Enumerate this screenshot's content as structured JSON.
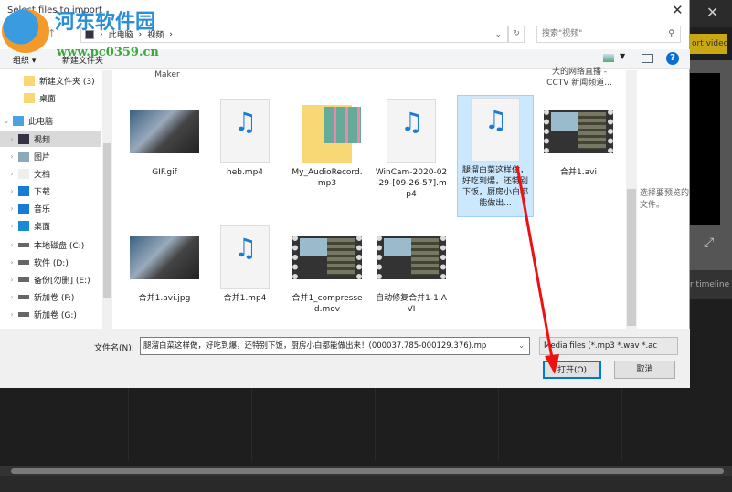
{
  "background_app": {
    "export_label": "ort video",
    "timeline_label": "r timeline"
  },
  "dialog": {
    "title": "Select files to import",
    "breadcrumb": [
      "此电脑",
      "视频"
    ],
    "search_placeholder": "搜索\"视频\"",
    "toolbar": {
      "organize": "组织 ▾",
      "new_folder": "新建文件夹",
      "help": "?"
    },
    "sidebar": [
      {
        "label": "新建文件夹 (3)",
        "icon": "folder"
      },
      {
        "label": "桌面",
        "icon": "folder"
      },
      {
        "label": "此电脑",
        "icon": "computer",
        "expanded": true
      },
      {
        "label": "视频",
        "icon": "video",
        "selected": true
      },
      {
        "label": "图片",
        "icon": "picture"
      },
      {
        "label": "文档",
        "icon": "document"
      },
      {
        "label": "下载",
        "icon": "download"
      },
      {
        "label": "音乐",
        "icon": "music"
      },
      {
        "label": "桌面",
        "icon": "desktop"
      },
      {
        "label": "本地磁盘 (C:)",
        "icon": "drive"
      },
      {
        "label": "软件 (D:)",
        "icon": "drive"
      },
      {
        "label": "备份[勿删] (E:)",
        "icon": "drive"
      },
      {
        "label": "新加卷 (F:)",
        "icon": "drive"
      },
      {
        "label": "新加卷 (G:)",
        "icon": "drive"
      }
    ],
    "cut_off_labels": [
      "Maker",
      "大的网络直播 - CCTV 新闻频道..."
    ],
    "files": [
      {
        "name": "GIF.gif",
        "type": "image"
      },
      {
        "name": "heb.mp4",
        "type": "media"
      },
      {
        "name": "My_AudioRecord.mp3",
        "type": "folder"
      },
      {
        "name": "WinCam-2020-02-29-[09-26-57].mp4",
        "type": "media"
      },
      {
        "name": "腿溜白菜这样做，好吃到爆，还特别下饭，厨房小白都能做出...",
        "type": "media",
        "selected": true
      },
      {
        "name": "合并1.avi",
        "type": "film"
      },
      {
        "name": "合并1.avi.jpg",
        "type": "image"
      },
      {
        "name": "合并1.mp4",
        "type": "media"
      },
      {
        "name": "合并1_compressed.mov",
        "type": "film"
      },
      {
        "name": "自动修复合并1-1.AVI",
        "type": "film"
      }
    ],
    "preview_text": "选择要预览的文件。",
    "filename_label": "文件名(N):",
    "filename_value": "腿溜白菜这样做，好吃到爆，还特别下饭，厨房小白都能做出来！(000037.785-000129.376).mp",
    "filter_value": "Media files (*.mp3 *.wav *.ac",
    "open_label": "打开(O)",
    "cancel_label": "取消"
  },
  "watermark": {
    "name": "河东软件园",
    "url": "www.pc0359.cn"
  }
}
